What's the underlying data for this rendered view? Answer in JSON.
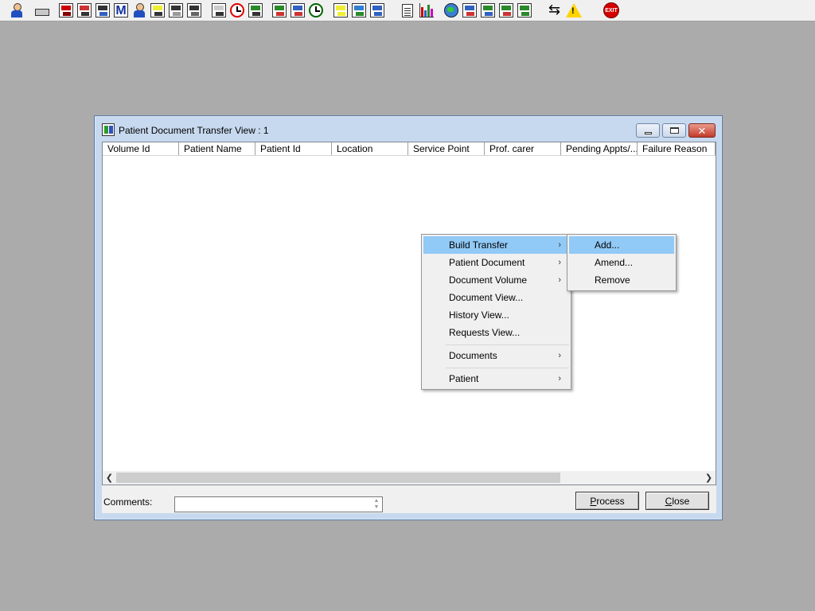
{
  "toolbar": {
    "icons": [
      "person-icon",
      "printer-icon",
      "book-icon",
      "edit-icon",
      "tools-icon",
      "m-icon",
      "patient-icon",
      "notes-icon",
      "folder-icon",
      "folder2-icon",
      "mail-icon",
      "clock-icon",
      "calculator-icon",
      "chart-icon",
      "calendar-icon",
      "timer-icon",
      "notepad-icon",
      "printer2-icon",
      "printer3-icon",
      "document-icon",
      "bar-chart-icon",
      "globe-icon",
      "forms-icon",
      "check-icon",
      "refresh-icon",
      "green-arrows-icon",
      "switch-icon",
      "warning-icon",
      "exit-icon"
    ],
    "exit_label": "EXIT"
  },
  "window": {
    "title": "Patient Document Transfer View : 1",
    "columns": [
      "Volume Id",
      "Patient Name",
      "Patient Id",
      "Location",
      "Service Point",
      "Prof. carer",
      "Pending Appts/...",
      "Failure Reason"
    ],
    "comments_label": "Comments:",
    "comments_value": "",
    "process_button": {
      "mnemonic": "P",
      "rest": "rocess"
    },
    "close_button": {
      "mnemonic": "C",
      "rest": "lose"
    }
  },
  "context_menu": {
    "items": [
      {
        "label": "Build Transfer",
        "submenu": true
      },
      {
        "label": "Patient Document",
        "submenu": true
      },
      {
        "label": "Document Volume",
        "submenu": true
      },
      {
        "label": "Document View...",
        "submenu": false
      },
      {
        "label": "History View...",
        "submenu": false
      },
      {
        "label": "Requests View...",
        "submenu": false
      },
      {
        "label": "Documents",
        "submenu": true
      },
      {
        "label": "Patient",
        "submenu": true
      }
    ],
    "arrow_glyph": "›"
  },
  "submenu": {
    "items": [
      "Add...",
      "Amend...",
      "Remove"
    ]
  }
}
